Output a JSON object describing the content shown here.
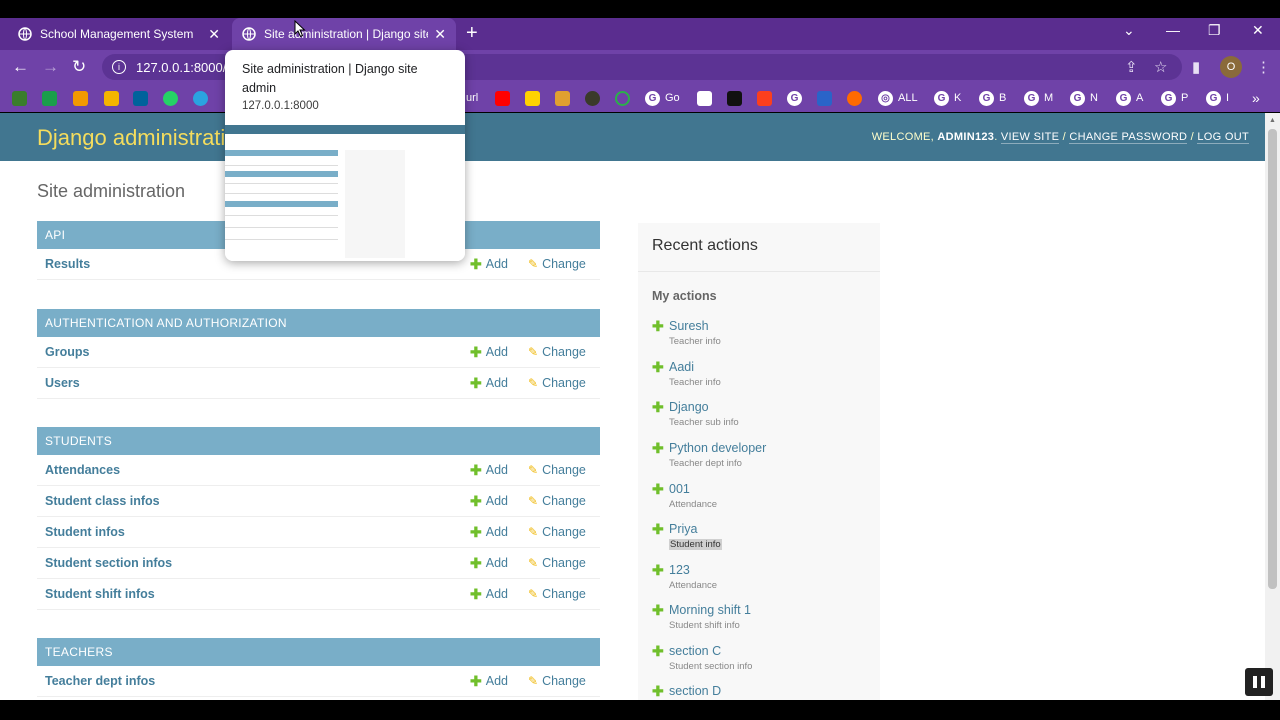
{
  "browser": {
    "tabs": [
      {
        "title": "School Management System",
        "active": false
      },
      {
        "title": "Site administration | Django site admin",
        "active": true
      }
    ],
    "address": "127.0.0.1:8000/a",
    "profile_initial": "O",
    "bookmarks": [
      "url",
      "Go",
      "ALL",
      "K",
      "B",
      "M",
      "N",
      "A",
      "P",
      "I"
    ]
  },
  "preview": {
    "title": "Site administration | Django site admin",
    "url": "127.0.0.1:8000"
  },
  "admin": {
    "brand": "Django administration",
    "welcome": "WELCOME,",
    "username": "ADMIN123",
    "view_site": "VIEW SITE",
    "change_password": "CHANGE PASSWORD",
    "log_out": "LOG OUT",
    "page_title": "Site administration",
    "add_label": "Add",
    "change_label": "Change",
    "modules": [
      {
        "caption": "API",
        "models": [
          "Results"
        ]
      },
      {
        "caption": "AUTHENTICATION AND AUTHORIZATION",
        "models": [
          "Groups",
          "Users"
        ]
      },
      {
        "caption": "STUDENTS",
        "models": [
          "Attendances",
          "Student class infos",
          "Student infos",
          "Student section infos",
          "Student shift infos"
        ]
      },
      {
        "caption": "TEACHERS",
        "models": [
          "Teacher dept infos"
        ]
      }
    ],
    "recent": {
      "title": "Recent actions",
      "my_actions": "My actions",
      "items": [
        {
          "name": "Suresh",
          "type": "Teacher info"
        },
        {
          "name": "Aadi",
          "type": "Teacher info"
        },
        {
          "name": "Django",
          "type": "Teacher sub info"
        },
        {
          "name": "Python developer",
          "type": "Teacher dept info"
        },
        {
          "name": "001",
          "type": "Attendance"
        },
        {
          "name": "Priya",
          "type": "Student info"
        },
        {
          "name": "123",
          "type": "Attendance"
        },
        {
          "name": "Morning shift 1",
          "type": "Student shift info"
        },
        {
          "name": "section C",
          "type": "Student section info"
        },
        {
          "name": "section D",
          "type": ""
        }
      ]
    }
  },
  "colors": {
    "chrome": "#6f42a8",
    "header": "#417690",
    "brand": "#f5dd5d",
    "module_caption": "#79aec8",
    "link": "#447e9b",
    "add_icon": "#70bf2b",
    "change_icon": "#efb80b"
  }
}
